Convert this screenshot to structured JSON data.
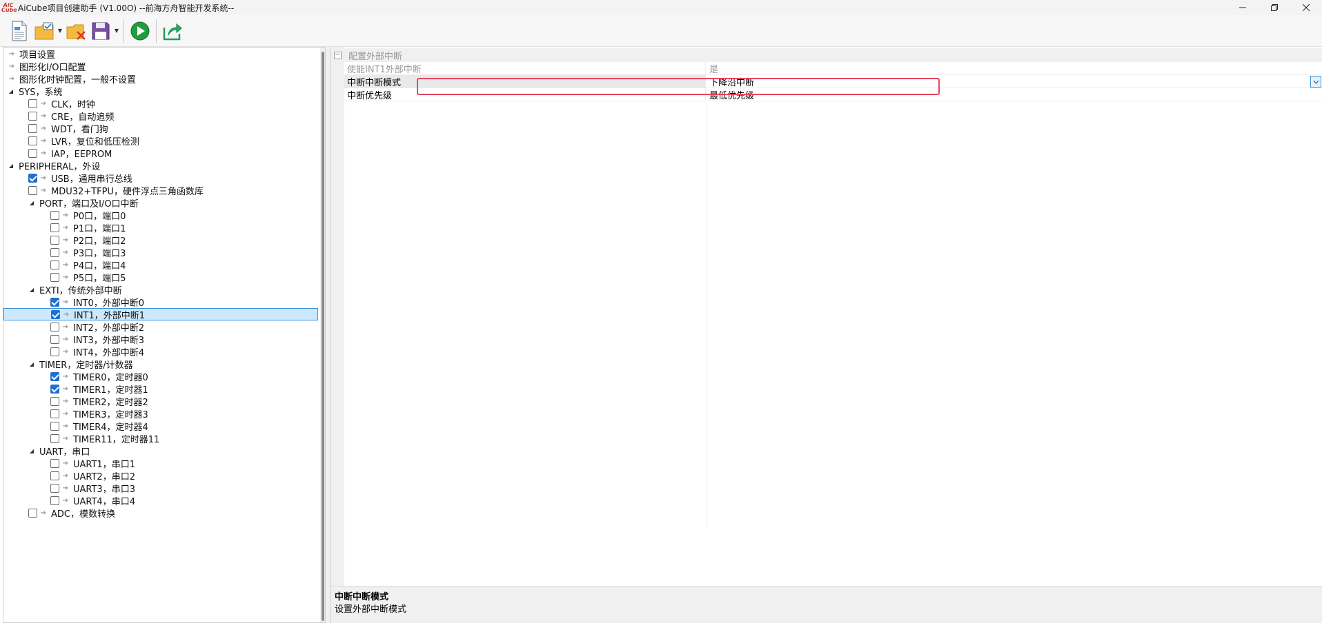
{
  "window": {
    "title": "AiCube项目创建助手 (V1.00O) --前海方舟智能开发系统--",
    "logo_text": "AiCube",
    "controls": [
      "minimize",
      "maximize",
      "close"
    ]
  },
  "toolbar": {
    "buttons": [
      {
        "name": "new-project",
        "icon": "new-document-icon"
      },
      {
        "name": "open-project",
        "icon": "folder-check-icon",
        "has_dropdown": true
      },
      {
        "name": "close-project",
        "icon": "folder-delete-icon"
      },
      {
        "name": "save-project",
        "icon": "floppy-disk-icon",
        "has_dropdown": true
      },
      {
        "name": "run",
        "icon": "play-icon"
      },
      {
        "name": "export",
        "icon": "export-arrow-icon"
      }
    ]
  },
  "tree": {
    "items": [
      {
        "label": "项目设置",
        "level": 0,
        "expander": "",
        "checkbox": null
      },
      {
        "label": "图形化I/O口配置",
        "level": 0,
        "expander": "",
        "checkbox": null
      },
      {
        "label": "图形化时钟配置，一般不设置",
        "level": 0,
        "expander": "",
        "checkbox": null
      },
      {
        "label": "SYS，系统",
        "level": 0,
        "expander": "expanded",
        "checkbox": null
      },
      {
        "label": "CLK，时钟",
        "level": 1,
        "expander": "",
        "checkbox": false
      },
      {
        "label": "CRE，自动追频",
        "level": 1,
        "expander": "",
        "checkbox": false
      },
      {
        "label": "WDT，看门狗",
        "level": 1,
        "expander": "",
        "checkbox": false
      },
      {
        "label": "LVR，复位和低压检测",
        "level": 1,
        "expander": "",
        "checkbox": false
      },
      {
        "label": "IAP，EEPROM",
        "level": 1,
        "expander": "",
        "checkbox": false
      },
      {
        "label": "PERIPHERAL，外设",
        "level": 0,
        "expander": "expanded",
        "checkbox": null
      },
      {
        "label": "USB，通用串行总线",
        "level": 1,
        "expander": "",
        "checkbox": true
      },
      {
        "label": "MDU32+TFPU，硬件浮点三角函数库",
        "level": 1,
        "expander": "",
        "checkbox": false
      },
      {
        "label": "PORT，端口及I/O口中断",
        "level": 1,
        "expander": "expanded",
        "checkbox": null
      },
      {
        "label": "P0口，端口0",
        "level": 2,
        "expander": "",
        "checkbox": false
      },
      {
        "label": "P1口，端口1",
        "level": 2,
        "expander": "",
        "checkbox": false
      },
      {
        "label": "P2口，端口2",
        "level": 2,
        "expander": "",
        "checkbox": false
      },
      {
        "label": "P3口，端口3",
        "level": 2,
        "expander": "",
        "checkbox": false
      },
      {
        "label": "P4口，端口4",
        "level": 2,
        "expander": "",
        "checkbox": false
      },
      {
        "label": "P5口，端口5",
        "level": 2,
        "expander": "",
        "checkbox": false
      },
      {
        "label": "EXTI，传统外部中断",
        "level": 1,
        "expander": "expanded",
        "checkbox": null
      },
      {
        "label": "INT0，外部中断0",
        "level": 2,
        "expander": "",
        "checkbox": true
      },
      {
        "label": "INT1，外部中断1",
        "level": 2,
        "expander": "",
        "checkbox": true,
        "selected": true
      },
      {
        "label": "INT2，外部中断2",
        "level": 2,
        "expander": "",
        "checkbox": false
      },
      {
        "label": "INT3，外部中断3",
        "level": 2,
        "expander": "",
        "checkbox": false
      },
      {
        "label": "INT4，外部中断4",
        "level": 2,
        "expander": "",
        "checkbox": false
      },
      {
        "label": "TIMER，定时器/计数器",
        "level": 1,
        "expander": "expanded",
        "checkbox": null
      },
      {
        "label": "TIMER0，定时器0",
        "level": 2,
        "expander": "",
        "checkbox": true
      },
      {
        "label": "TIMER1，定时器1",
        "level": 2,
        "expander": "",
        "checkbox": true
      },
      {
        "label": "TIMER2，定时器2",
        "level": 2,
        "expander": "",
        "checkbox": false
      },
      {
        "label": "TIMER3，定时器3",
        "level": 2,
        "expander": "",
        "checkbox": false
      },
      {
        "label": "TIMER4，定时器4",
        "level": 2,
        "expander": "",
        "checkbox": false
      },
      {
        "label": "TIMER11，定时器11",
        "level": 2,
        "expander": "",
        "checkbox": false
      },
      {
        "label": "UART，串口",
        "level": 1,
        "expander": "expanded",
        "checkbox": null
      },
      {
        "label": "UART1，串口1",
        "level": 2,
        "expander": "",
        "checkbox": false
      },
      {
        "label": "UART2，串口2",
        "level": 2,
        "expander": "",
        "checkbox": false
      },
      {
        "label": "UART3，串口3",
        "level": 2,
        "expander": "",
        "checkbox": false
      },
      {
        "label": "UART4，串口4",
        "level": 2,
        "expander": "",
        "checkbox": false
      },
      {
        "label": "ADC，模数转换",
        "level": 1,
        "expander": "",
        "checkbox": false
      }
    ]
  },
  "properties": {
    "category": "配置外部中断",
    "rows": [
      {
        "name": "使能INT1外部中断",
        "value": "是",
        "disabled": true
      },
      {
        "name": "中断中断模式",
        "value": "下降沿中断",
        "selected": true,
        "has_dropdown": true
      },
      {
        "name": "中断优先级",
        "value": "最低优先级"
      }
    ]
  },
  "description": {
    "title": "中断中断模式",
    "text": "设置外部中断模式"
  },
  "colors": {
    "highlight_box": "#e5475e",
    "selection_bg": "#cce8ff",
    "checkbox_on": "#1f6fd1"
  }
}
